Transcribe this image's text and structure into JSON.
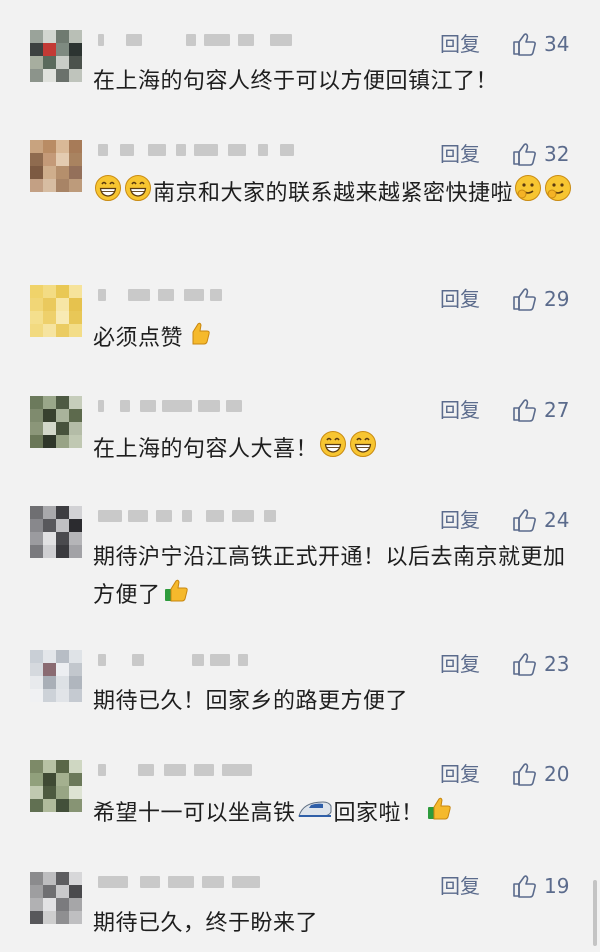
{
  "comments": [
    {
      "reply_label": "回复",
      "likes": "34",
      "text": "在上海的句容人终于可以方便回镇江了！",
      "emoji_after": [],
      "avatar_colors": [
        "#9aa39a",
        "#d2d6d0",
        "#6f7a70",
        "#b9bfb6",
        "#3c4140",
        "#c33a35",
        "#7e8a80",
        "#2c3431",
        "#a7ae9f",
        "#5a6a5c",
        "#c9cdc7",
        "#4b524c",
        "#8c948b",
        "#e0e2dd",
        "#6a716b",
        "#bfc4bc"
      ]
    },
    {
      "reply_label": "回复",
      "likes": "32",
      "text_before_emoji": [],
      "text": "南京和大家的联系越来越紧密快捷啦",
      "emoji_before": [
        "grin-icon",
        "grin-icon"
      ],
      "emoji_after": [
        "ok-hand-face-icon",
        "ok-hand-face-icon"
      ],
      "avatar_colors": [
        "#c8a37f",
        "#b98c64",
        "#d9b997",
        "#a77b58",
        "#8f6b4f",
        "#c49a78",
        "#e3cbb0",
        "#a98360",
        "#7d5a42",
        "#cfae8c",
        "#b58f6c",
        "#94705a",
        "#c3a084",
        "#d7bda2",
        "#a88466",
        "#bd9b7b"
      ]
    },
    {
      "reply_label": "回复",
      "likes": "29",
      "text": "必须点赞",
      "emoji_after": [
        "thumbs-up-icon"
      ],
      "avatar_colors": [
        "#f0d36a",
        "#f3dc84",
        "#e9c855",
        "#f6e39b",
        "#f1d676",
        "#eac95d",
        "#f7e6a6",
        "#e6c24e",
        "#f4df8d",
        "#eed06b",
        "#f8eab4",
        "#e8c757",
        "#f2da80",
        "#f6e4a0",
        "#ebcc62",
        "#f3dd88"
      ]
    },
    {
      "reply_label": "回复",
      "likes": "27",
      "text": "在上海的句容人大喜！",
      "emoji_after": [
        "grin-icon-2",
        "grin-icon-2"
      ],
      "avatar_colors": [
        "#6c7a5c",
        "#9aa78a",
        "#4e5a43",
        "#c6cdbb",
        "#7f8b6e",
        "#38412f",
        "#a9b39b",
        "#5d6a4d",
        "#8b9679",
        "#d3d8ca",
        "#47523c",
        "#b4bca7",
        "#6a7758",
        "#2f372a",
        "#98a386",
        "#c0c8b2"
      ]
    },
    {
      "reply_label": "回复",
      "likes": "24",
      "text": "期待沪宁沿江高铁正式开通！以后去南京就更加方便了",
      "emoji_after": [
        "thumbs-up-icon-green"
      ],
      "avatar_colors": [
        "#6f6f72",
        "#a9a9ac",
        "#3e3e42",
        "#d2d2d5",
        "#88888c",
        "#58585c",
        "#c0c0c3",
        "#2b2b2f",
        "#9b9b9f",
        "#e1e1e3",
        "#4a4a4e",
        "#b5b5b8",
        "#7a7a7e",
        "#cfcfd2",
        "#3a3a3e",
        "#a2a2a6"
      ]
    },
    {
      "reply_label": "回复",
      "likes": "23",
      "text": "期待已久！回家乡的路更方便了",
      "emoji_after": [],
      "avatar_colors": [
        "#c9cfd6",
        "#e3e6ea",
        "#b7bdc5",
        "#dfe3e7",
        "#d5d9de",
        "#8a6b72",
        "#eceef1",
        "#c2c7cd",
        "#e8eaed",
        "#a9afb7",
        "#dde1e5",
        "#b0b6be",
        "#f0f1f3",
        "#cdd2d8",
        "#e1e4e8",
        "#c5cad1"
      ]
    },
    {
      "reply_label": "回复",
      "likes": "20",
      "text": "希望十一可以坐高铁",
      "text2": "回家啦！",
      "emoji_mid": [
        "train-icon"
      ],
      "emoji_after": [
        "thumbs-up-icon-green"
      ],
      "avatar_colors": [
        "#7d8a68",
        "#b7c2a4",
        "#5a6748",
        "#cfd7c2",
        "#91a07c",
        "#3f4a33",
        "#a4b08f",
        "#6b795a",
        "#c0c9b0",
        "#4d5a3f",
        "#98a584",
        "#dde3d3",
        "#617052",
        "#b0bb9c",
        "#43503a",
        "#879474"
      ]
    },
    {
      "reply_label": "回复",
      "likes": "19",
      "text": "期待已久，终于盼来了",
      "emoji_after": [],
      "avatar_colors": [
        "#8b8b8d",
        "#bdbdbf",
        "#5d5d60",
        "#d7d7d9",
        "#9e9ea0",
        "#6f6f72",
        "#c9c9cb",
        "#4a4a4d",
        "#b1b1b3",
        "#e2e2e4",
        "#7b7b7e",
        "#a6a6a8",
        "#58585b",
        "#cecece",
        "#8f8f91",
        "#bfbfc1"
      ]
    }
  ],
  "colors": {
    "link_blue": "#5b6b8c",
    "text": "#1e1e1e",
    "bg": "#f2f2f2"
  }
}
